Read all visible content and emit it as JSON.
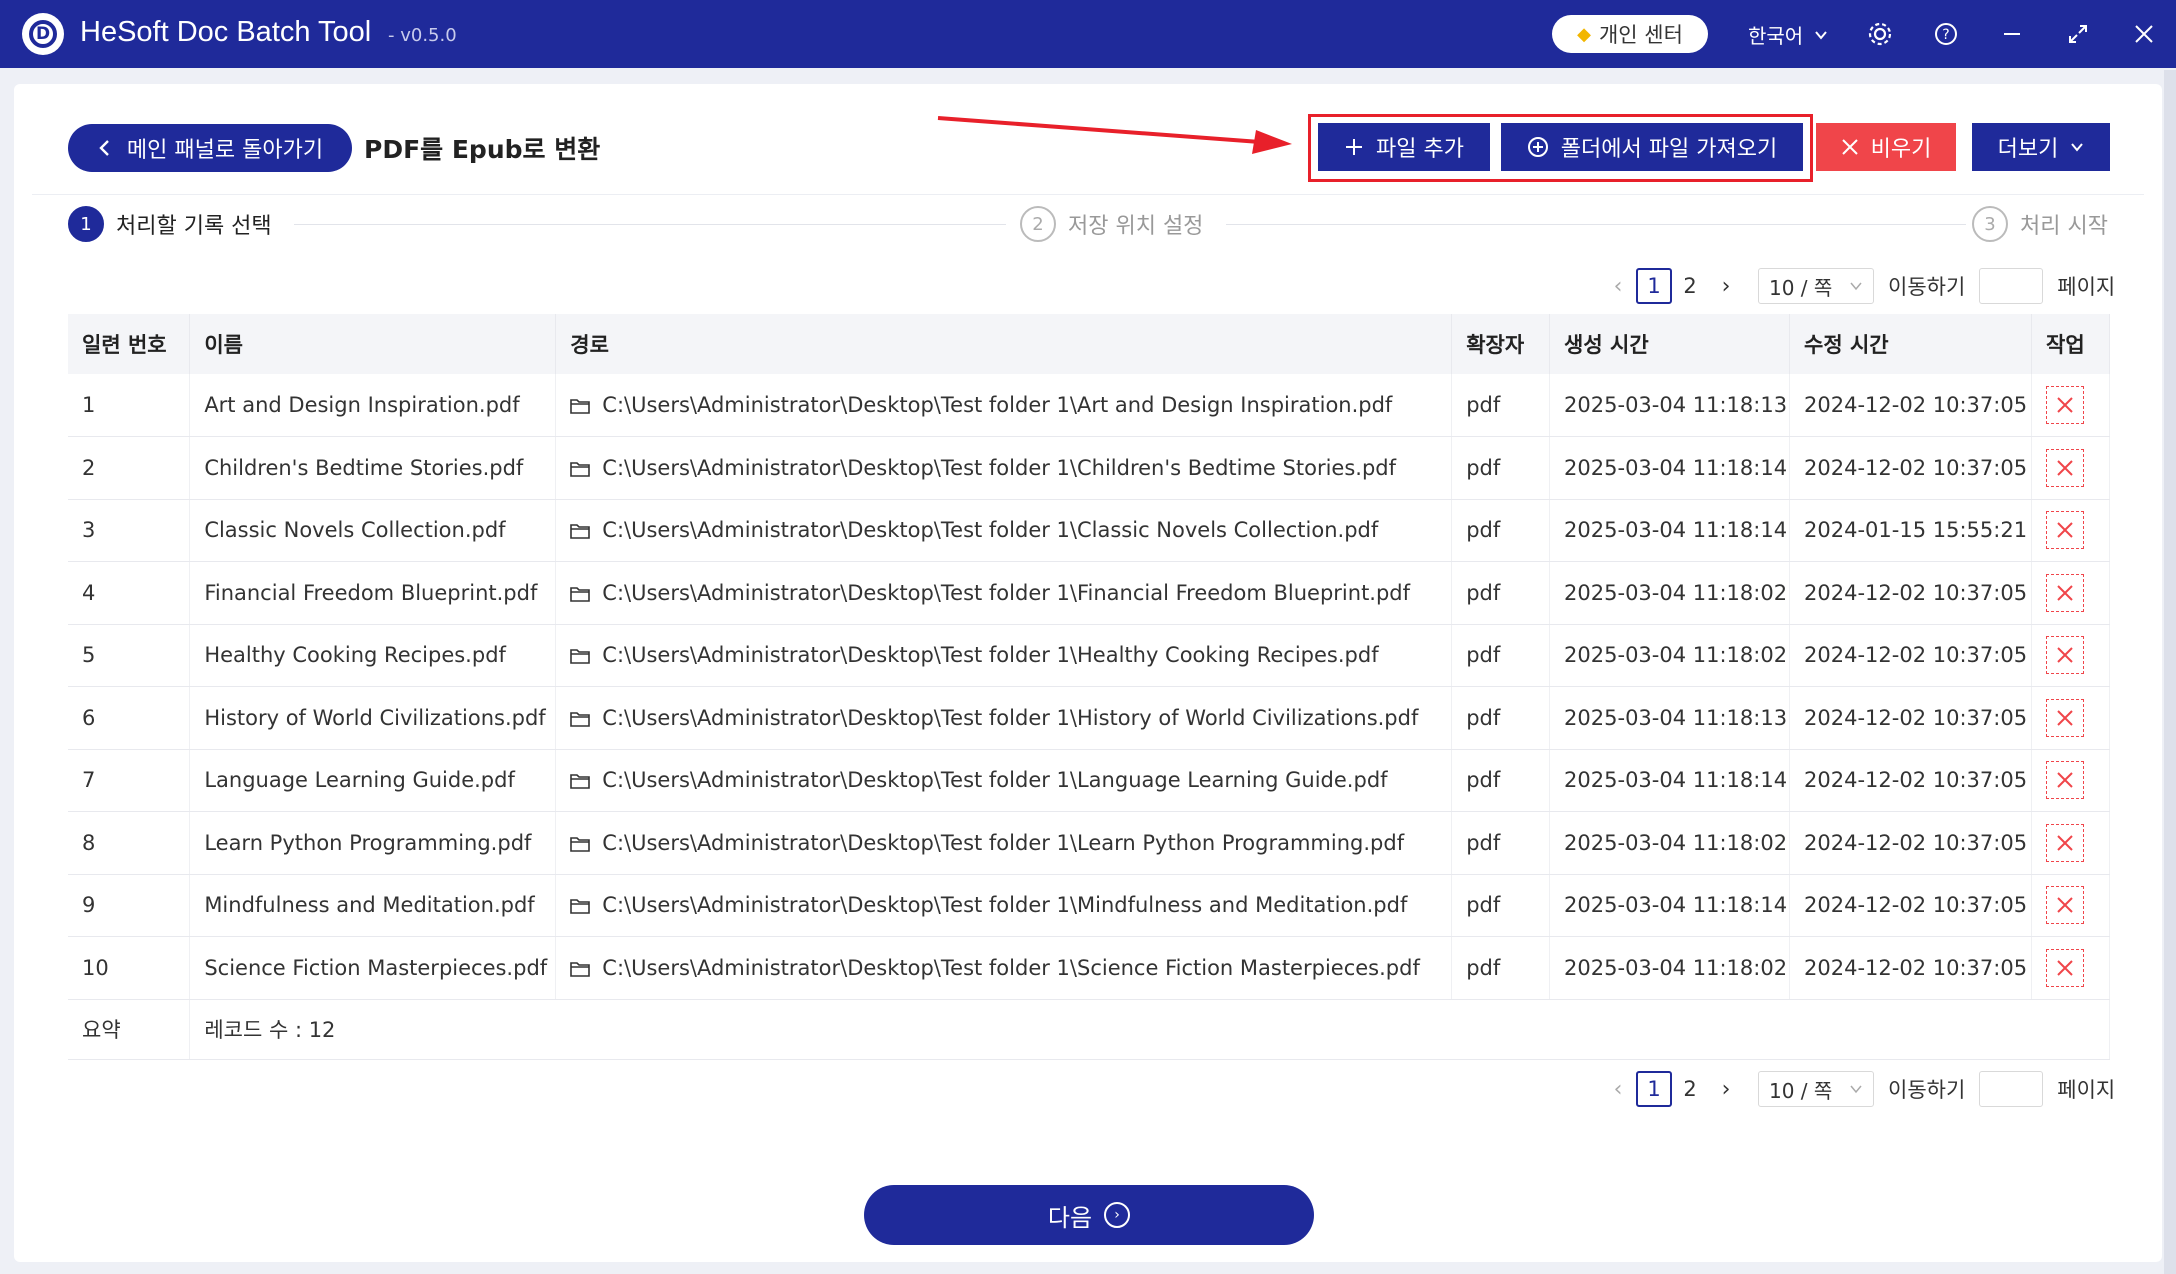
{
  "titlebar": {
    "logo_letter": "D",
    "app_name": "HeSoft Doc Batch Tool",
    "version": "- v0.5.0",
    "vip_label": "개인 센터",
    "language": "한국어"
  },
  "header": {
    "back_label": "메인 패널로 돌아가기",
    "page_title": "PDF를 Epub로 변환",
    "add_file_label": "파일 추가",
    "import_folder_label": "폴더에서 파일 가져오기",
    "clear_label": "비우기",
    "more_label": "더보기"
  },
  "steps": [
    {
      "num": "1",
      "label": "처리할 기록 선택"
    },
    {
      "num": "2",
      "label": "저장 위치 설정"
    },
    {
      "num": "3",
      "label": "처리 시작"
    }
  ],
  "pagination": {
    "pages": [
      "1",
      "2"
    ],
    "current_page": "1",
    "page_size": "10 / 쪽",
    "goto_label": "이동하기",
    "page_label": "페이지"
  },
  "table": {
    "columns": [
      "일련 번호",
      "이름",
      "경로",
      "확장자",
      "생성 시간",
      "수정 시간",
      "작업"
    ],
    "rows": [
      {
        "no": "1",
        "name": "Art and Design Inspiration.pdf",
        "path": "C:\\Users\\Administrator\\Desktop\\Test folder 1\\Art and Design Inspiration.pdf",
        "ext": "pdf",
        "created": "2025-03-04 11:18:13",
        "modified": "2024-12-02 10:37:05"
      },
      {
        "no": "2",
        "name": "Children's Bedtime Stories.pdf",
        "path": "C:\\Users\\Administrator\\Desktop\\Test folder 1\\Children's Bedtime Stories.pdf",
        "ext": "pdf",
        "created": "2025-03-04 11:18:14",
        "modified": "2024-12-02 10:37:05"
      },
      {
        "no": "3",
        "name": "Classic Novels Collection.pdf",
        "path": "C:\\Users\\Administrator\\Desktop\\Test folder 1\\Classic Novels Collection.pdf",
        "ext": "pdf",
        "created": "2025-03-04 11:18:14",
        "modified": "2024-01-15 15:55:21"
      },
      {
        "no": "4",
        "name": "Financial Freedom Blueprint.pdf",
        "path": "C:\\Users\\Administrator\\Desktop\\Test folder 1\\Financial Freedom Blueprint.pdf",
        "ext": "pdf",
        "created": "2025-03-04 11:18:02",
        "modified": "2024-12-02 10:37:05"
      },
      {
        "no": "5",
        "name": "Healthy Cooking Recipes.pdf",
        "path": "C:\\Users\\Administrator\\Desktop\\Test folder 1\\Healthy Cooking Recipes.pdf",
        "ext": "pdf",
        "created": "2025-03-04 11:18:02",
        "modified": "2024-12-02 10:37:05"
      },
      {
        "no": "6",
        "name": "History of World Civilizations.pdf",
        "path": "C:\\Users\\Administrator\\Desktop\\Test folder 1\\History of World Civilizations.pdf",
        "ext": "pdf",
        "created": "2025-03-04 11:18:13",
        "modified": "2024-12-02 10:37:05"
      },
      {
        "no": "7",
        "name": "Language Learning Guide.pdf",
        "path": "C:\\Users\\Administrator\\Desktop\\Test folder 1\\Language Learning Guide.pdf",
        "ext": "pdf",
        "created": "2025-03-04 11:18:14",
        "modified": "2024-12-02 10:37:05"
      },
      {
        "no": "8",
        "name": "Learn Python Programming.pdf",
        "path": "C:\\Users\\Administrator\\Desktop\\Test folder 1\\Learn Python Programming.pdf",
        "ext": "pdf",
        "created": "2025-03-04 11:18:02",
        "modified": "2024-12-02 10:37:05"
      },
      {
        "no": "9",
        "name": "Mindfulness and Meditation.pdf",
        "path": "C:\\Users\\Administrator\\Desktop\\Test folder 1\\Mindfulness and Meditation.pdf",
        "ext": "pdf",
        "created": "2025-03-04 11:18:14",
        "modified": "2024-12-02 10:37:05"
      },
      {
        "no": "10",
        "name": "Science Fiction Masterpieces.pdf",
        "path": "C:\\Users\\Administrator\\Desktop\\Test folder 1\\Science Fiction Masterpieces.pdf",
        "ext": "pdf",
        "created": "2025-03-04 11:18:02",
        "modified": "2024-12-02 10:37:05"
      }
    ],
    "summary_label": "요약",
    "summary_value": "레코드 수 : 12"
  },
  "footer": {
    "next_label": "다음"
  },
  "colors": {
    "primary": "#1f2a9a",
    "danger": "#f0454a",
    "highlight": "#e8202a"
  },
  "icons": [
    "close-icon",
    "help-icon",
    "settings-icon",
    "minimize-icon",
    "maximize-icon",
    "diamond-icon",
    "folder-icon",
    "delete-icon",
    "plus-icon",
    "plus-circle-icon",
    "chevron-left-icon",
    "chevron-down-icon",
    "arrow-right-circle-icon"
  ]
}
